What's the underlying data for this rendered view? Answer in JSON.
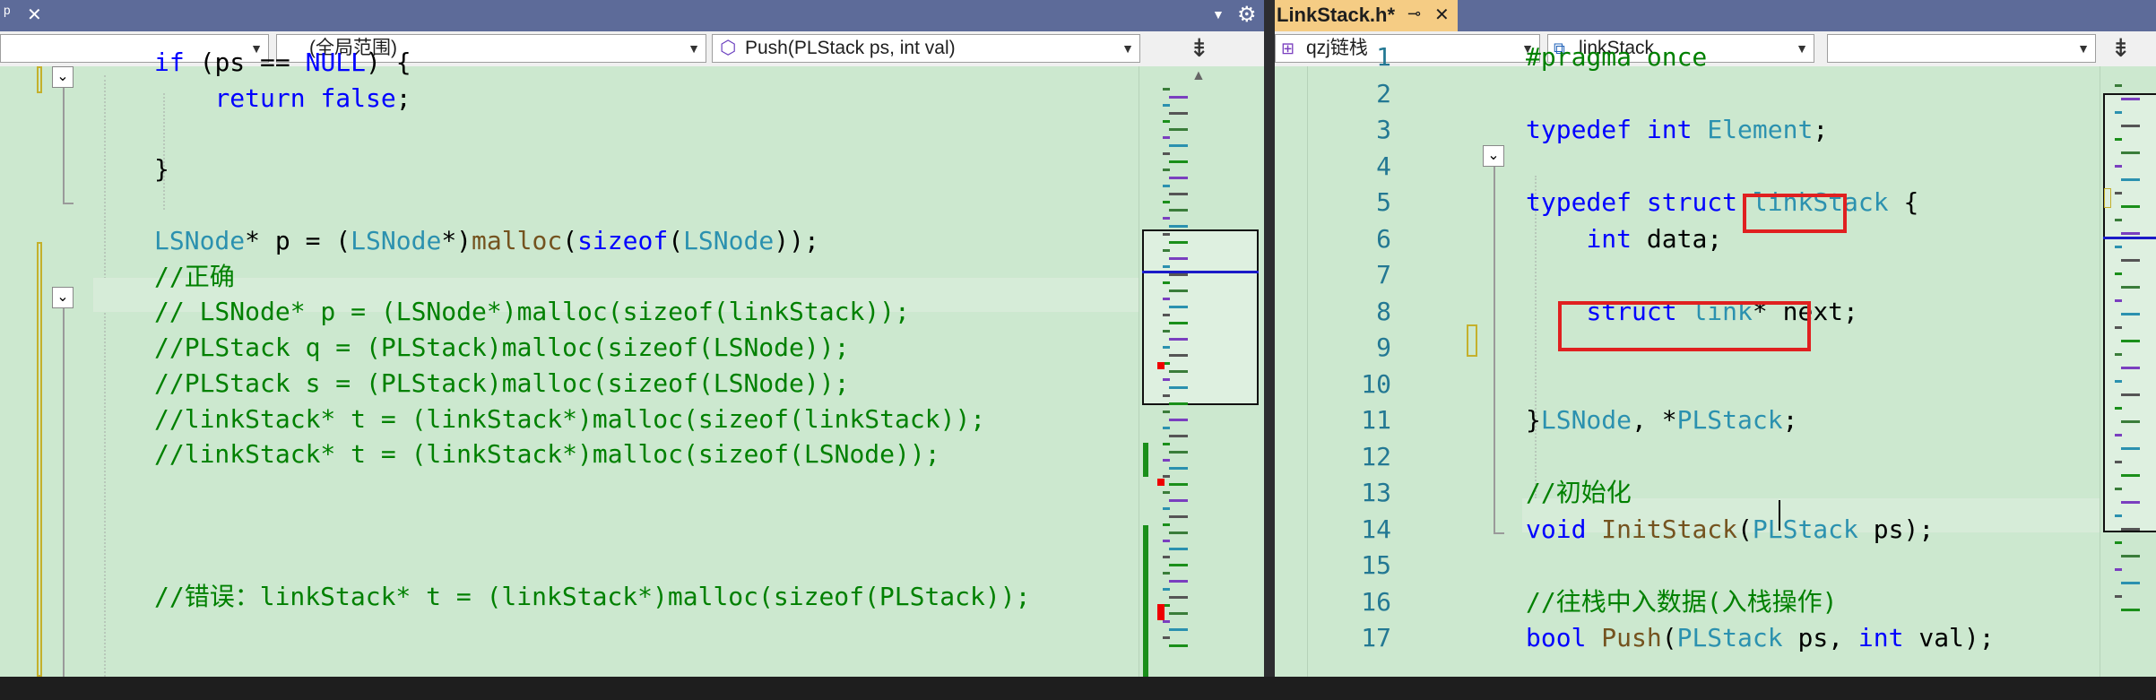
{
  "left_tab": {
    "pin_glyph": "ᵖ",
    "close_glyph": "✕"
  },
  "left_toolbar": {
    "scope_label": "(全局范围)",
    "member_label": "Push(PLStack ps, int val)",
    "split_glyph": "⇟"
  },
  "left_code": [
    {
      "tokens": [
        [
          "kw",
          "if"
        ],
        [
          "n",
          " ("
        ],
        [
          "n",
          "ps"
        ],
        [
          "n",
          " == "
        ],
        [
          "kw",
          "NULL"
        ],
        [
          "n",
          ") {"
        ]
      ]
    },
    {
      "tokens": [
        [
          "n",
          "    "
        ],
        [
          "kw",
          "return"
        ],
        [
          "n",
          " "
        ],
        [
          "kw",
          "false"
        ],
        [
          "n",
          ";"
        ]
      ]
    },
    {
      "tokens": []
    },
    {
      "tokens": [
        [
          "n",
          "}"
        ]
      ]
    },
    {
      "tokens": []
    },
    {
      "tokens": [
        [
          "ty",
          "LSNode"
        ],
        [
          "n",
          "* p = ("
        ],
        [
          "ty",
          "LSNode"
        ],
        [
          "n",
          "*)"
        ],
        [
          "fn",
          "malloc"
        ],
        [
          "n",
          "("
        ],
        [
          "kw",
          "sizeof"
        ],
        [
          "n",
          "("
        ],
        [
          "ty",
          "LSNode"
        ],
        [
          "n",
          "));"
        ]
      ]
    },
    {
      "tokens": [
        [
          "cm",
          "//正确"
        ]
      ]
    },
    {
      "tokens": [
        [
          "cm",
          "// LSNode* p = (LSNode*)malloc(sizeof(linkStack));"
        ]
      ]
    },
    {
      "tokens": [
        [
          "cm",
          "//PLStack q = (PLStack)malloc(sizeof(LSNode));"
        ]
      ]
    },
    {
      "tokens": [
        [
          "cm",
          "//PLStack s = (PLStack)malloc(sizeof(LSNode));"
        ]
      ]
    },
    {
      "tokens": [
        [
          "cm",
          "//linkStack* t = (linkStack*)malloc(sizeof(linkStack));"
        ]
      ]
    },
    {
      "tokens": [
        [
          "cm",
          "//linkStack* t = (linkStack*)malloc(sizeof(LSNode));"
        ]
      ]
    },
    {
      "tokens": []
    },
    {
      "tokens": []
    },
    {
      "tokens": []
    },
    {
      "tokens": [
        [
          "cm",
          "//错误：linkStack* t = (linkStack*)malloc(sizeof(PLStack));"
        ]
      ]
    }
  ],
  "right_tab": {
    "title": "LinkStack.h*",
    "pin_glyph": "⊸",
    "close_glyph": "✕"
  },
  "right_toolbar": {
    "project_label": "qzj链栈",
    "scope_label": "linkStack",
    "member_label": ""
  },
  "right_code": [
    {
      "n": "1",
      "tokens": [
        [
          "cm",
          "#pragma once"
        ]
      ]
    },
    {
      "n": "2",
      "tokens": []
    },
    {
      "n": "3",
      "tokens": [
        [
          "kw",
          "typedef"
        ],
        [
          "n",
          " "
        ],
        [
          "kw",
          "int"
        ],
        [
          "n",
          " "
        ],
        [
          "ty",
          "Element"
        ],
        [
          "n",
          ";"
        ]
      ]
    },
    {
      "n": "4",
      "tokens": []
    },
    {
      "n": "5",
      "tokens": [
        [
          "kw",
          "typedef"
        ],
        [
          "n",
          " "
        ],
        [
          "kw",
          "struct"
        ],
        [
          "n",
          " "
        ],
        [
          "ty",
          "linkStack"
        ],
        [
          "n",
          " {"
        ]
      ]
    },
    {
      "n": "6",
      "tokens": [
        [
          "n",
          "    "
        ],
        [
          "kw",
          "int"
        ],
        [
          "n",
          " data;"
        ]
      ]
    },
    {
      "n": "7",
      "tokens": []
    },
    {
      "n": "8",
      "tokens": [
        [
          "n",
          "    "
        ],
        [
          "kw",
          "struct"
        ],
        [
          "n",
          " "
        ],
        [
          "ty",
          "link"
        ],
        [
          "n",
          "* next;"
        ]
      ]
    },
    {
      "n": "9",
      "tokens": []
    },
    {
      "n": "10",
      "tokens": []
    },
    {
      "n": "11",
      "tokens": [
        [
          "n",
          "}"
        ],
        [
          "ty",
          "LSNode"
        ],
        [
          "n",
          ", *"
        ],
        [
          "ty",
          "PLStack"
        ],
        [
          "n",
          ";"
        ]
      ]
    },
    {
      "n": "12",
      "tokens": []
    },
    {
      "n": "13",
      "tokens": [
        [
          "cm",
          "//初始化"
        ]
      ]
    },
    {
      "n": "14",
      "tokens": [
        [
          "kw",
          "void"
        ],
        [
          "n",
          " "
        ],
        [
          "fn",
          "InitStack"
        ],
        [
          "n",
          "("
        ],
        [
          "ty",
          "PLStack"
        ],
        [
          "n",
          " ps);"
        ]
      ]
    },
    {
      "n": "15",
      "tokens": []
    },
    {
      "n": "16",
      "tokens": [
        [
          "cm",
          "//往栈中入数据(入栈操作)"
        ]
      ]
    },
    {
      "n": "17",
      "tokens": [
        [
          "kw",
          "bool"
        ],
        [
          "n",
          " "
        ],
        [
          "fn",
          "Push"
        ],
        [
          "n",
          "("
        ],
        [
          "ty",
          "PLStack"
        ],
        [
          "n",
          " ps, "
        ],
        [
          "kw",
          "int"
        ],
        [
          "n",
          " val);"
        ]
      ]
    }
  ],
  "colors": {
    "editor_bg": "#cce8cf",
    "keyword": "#0000ff",
    "type": "#2b91af",
    "comment": "#008000",
    "function": "#74531f",
    "highlight_box": "#e02020",
    "active_tab": "#f5cc84",
    "tab_bar": "#5d6b99"
  },
  "icons": [
    "pin-icon",
    "close-icon",
    "dropdown-arrow-icon",
    "split-icon",
    "settings-icon",
    "collapse-icon",
    "class-icon",
    "method-icon",
    "file-icon"
  ]
}
